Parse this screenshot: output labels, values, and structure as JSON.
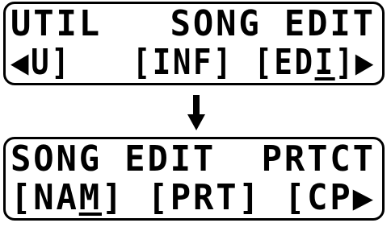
{
  "screen_before": {
    "line1": "UTIL   SONG EDIT",
    "line2_left": "◀U]",
    "line2_mid": "[INF]",
    "line2_right_a": "[ED",
    "line2_right_cursor": "I",
    "line2_right_b": "]▶"
  },
  "screen_after": {
    "line1": "SONG EDIT  PRTCT",
    "line2_a": "[NA",
    "line2_cursor": "M",
    "line2_b": "] [PRT] [CP▶"
  },
  "icons": {
    "transition": "arrow-down-icon"
  }
}
